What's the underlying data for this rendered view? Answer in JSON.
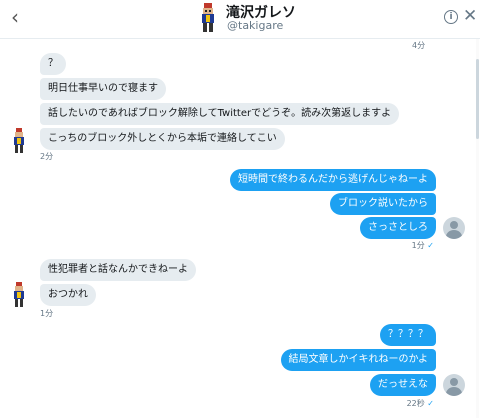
{
  "header": {
    "back_icon": "‹",
    "name": "滝沢ガレソ",
    "handle": "@takigare",
    "info_icon": "i",
    "close_icon": "✕"
  },
  "top_timestamp": "4分",
  "group1": {
    "messages": [
      "？",
      "明日仕事早いので寝ます",
      "話したいのであればブロック解除してTwitterでどうぞ。読み次第返しますよ",
      "こっちのブロック外しとくから本垢で連絡してこい"
    ],
    "timestamp": "2分"
  },
  "group2": {
    "messages": [
      "短時間で終わるんだから逃げんじゃねーよ",
      "ブロック説いたから",
      "さっさとしろ"
    ],
    "timestamp": "1分",
    "check": "✓"
  },
  "group3": {
    "messages": [
      "性犯罪者と話なんかできねーよ",
      "おつかれ"
    ],
    "timestamp": "1分"
  },
  "group4": {
    "messages": [
      "？？？？",
      "結局文章しかイキれねーのかよ",
      "だっせえな"
    ],
    "timestamp": "22秒",
    "check": "✓"
  },
  "colors": {
    "outgoing": "#1da1f2",
    "incoming": "#e6ecf0",
    "muted": "#657786"
  },
  "icons": [
    "chevron-left-icon",
    "info-icon",
    "close-icon",
    "default-avatar-icon"
  ]
}
